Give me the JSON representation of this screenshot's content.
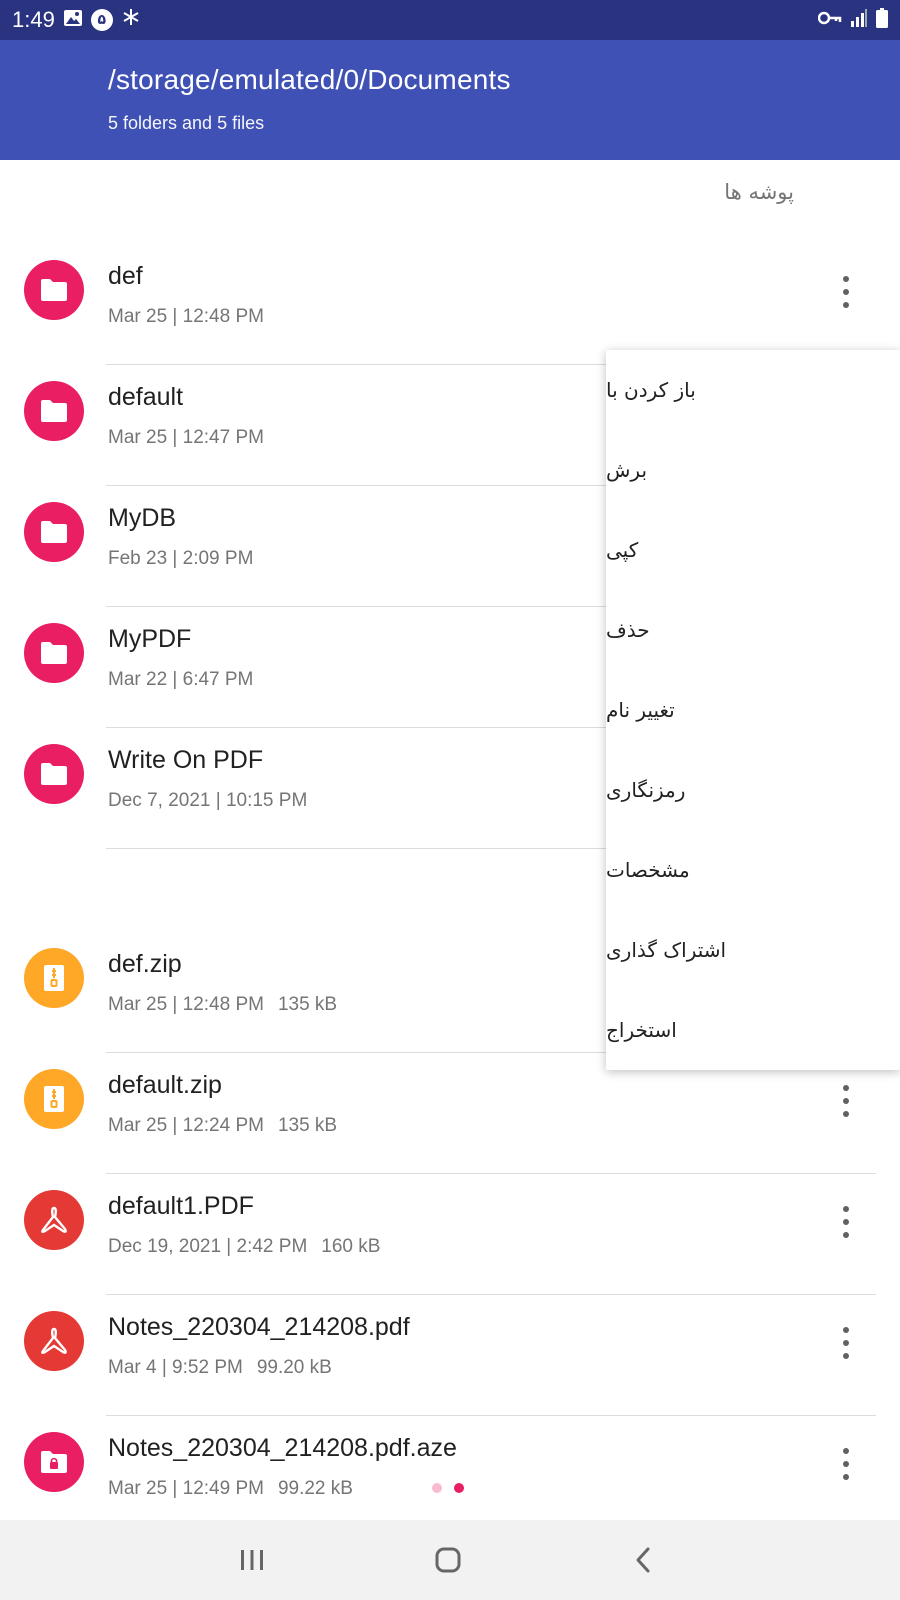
{
  "status_bar": {
    "time": "1:49",
    "notification_badge": "۵"
  },
  "app_bar": {
    "title": "/storage/emulated/0/Documents",
    "subtitle": "5 folders and 5 files"
  },
  "section_header": "پوشه ها",
  "colors": {
    "primary": "#3f51b5",
    "status_bar": "#2a3380",
    "folder": "#e91e63",
    "zip": "#ffa726",
    "pdf": "#e53935",
    "locked": "#e91e63"
  },
  "folders": [
    {
      "name": "def",
      "meta": "Mar 25 | 12:48 PM",
      "icon": "folder-icon"
    },
    {
      "name": "default",
      "meta": "Mar 25 | 12:47 PM",
      "icon": "folder-icon"
    },
    {
      "name": "MyDB",
      "meta": "Feb 23 | 2:09 PM",
      "icon": "folder-icon"
    },
    {
      "name": "MyPDF",
      "meta": "Mar 22 | 6:47 PM",
      "icon": "folder-icon"
    },
    {
      "name": "Write On PDF",
      "meta": "Dec 7, 2021 | 10:15 PM",
      "icon": "folder-icon"
    }
  ],
  "files": [
    {
      "name": "def.zip",
      "meta": "Mar 25 | 12:48 PM",
      "size": "135 kB",
      "icon": "zip-icon"
    },
    {
      "name": "default.zip",
      "meta": "Mar 25 | 12:24 PM",
      "size": "135 kB",
      "icon": "zip-icon"
    },
    {
      "name": "default1.PDF",
      "meta": "Dec 19, 2021 | 2:42 PM",
      "size": "160 kB",
      "icon": "pdf-icon"
    },
    {
      "name": "Notes_220304_214208.pdf",
      "meta": "Mar 4 | 9:52 PM",
      "size": "99.20 kB",
      "icon": "pdf-icon"
    },
    {
      "name": "Notes_220304_214208.pdf.aze",
      "meta": "Mar 25 | 12:49 PM",
      "size": "99.22 kB",
      "icon": "locked-file-icon"
    }
  ],
  "context_menu": {
    "items": [
      "باز کردن با",
      "برش",
      "کپی",
      "حذف",
      "تغییر نام",
      "رمزنگاری",
      "مشخصات",
      "اشتراک گذاری",
      "استخراج"
    ]
  }
}
